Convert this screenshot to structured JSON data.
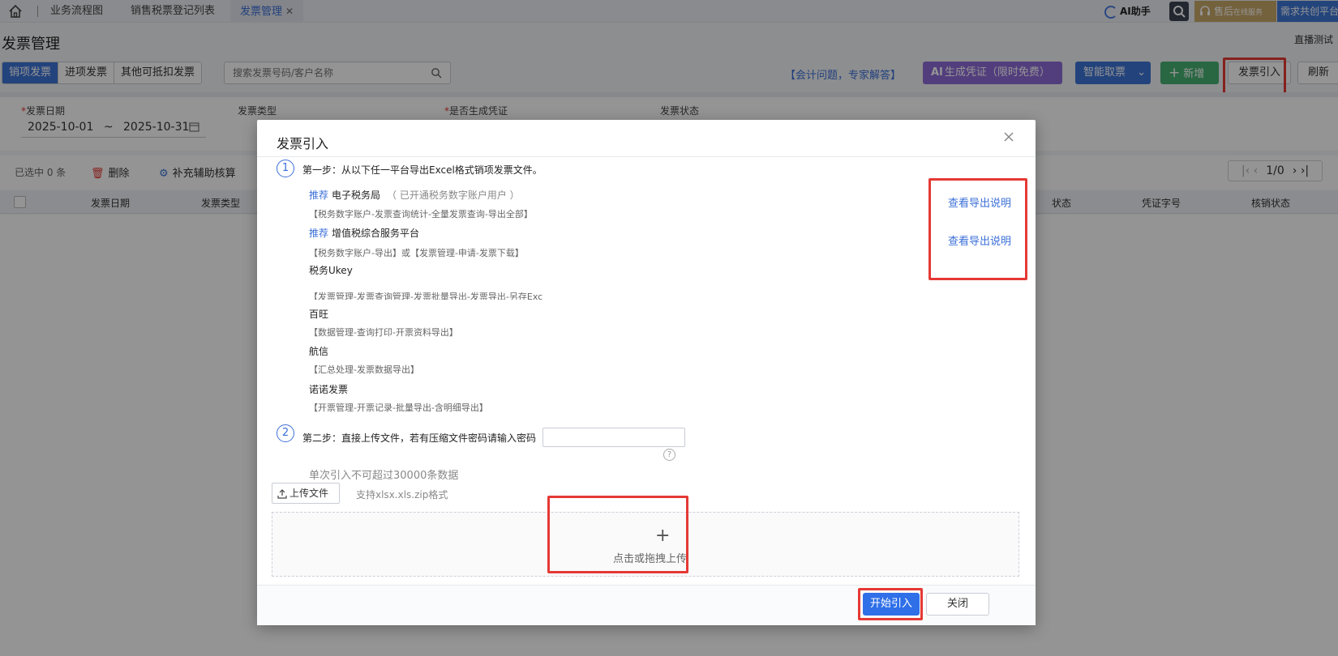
{
  "tabs": [
    {
      "label": "业务流程图",
      "active": false
    },
    {
      "label": "销售税票登记列表",
      "active": false
    },
    {
      "label": "发票管理",
      "active": true
    }
  ],
  "header": {
    "ai_help": "AI助手",
    "after_sale": "售后",
    "after_sale_sub": "在线服务",
    "demand": "需求共创平台"
  },
  "page": {
    "title": "发票管理",
    "live_test": "直播测试"
  },
  "toolbar": {
    "segments": [
      {
        "label": "销项发票",
        "active": true
      },
      {
        "label": "进项发票",
        "active": false
      },
      {
        "label": "其他可抵扣发票",
        "active": false
      }
    ],
    "search_placeholder": "搜索发票号码/客户名称",
    "accounting_link": "【会计问题，专家解答】",
    "gen_voucher": "生成凭证（限时免费）",
    "smart_fetch": "智能取票",
    "new": "新增",
    "import": "发票引入",
    "refresh": "刷新"
  },
  "filters": {
    "date_label": "发票日期",
    "date_start": "2025-10-01",
    "date_sep": "~",
    "date_end": "2025-10-31",
    "type_label": "发票类型",
    "voucher_label": "是否生成凭证",
    "status_label": "发票状态"
  },
  "list": {
    "selected": "已选中 0 条",
    "delete": "删除",
    "aux": "补充辅助核算",
    "pager": "1/0",
    "columns": [
      "发票日期",
      "发票类型",
      "状态",
      "凭证字号",
      "核销状态"
    ]
  },
  "modal": {
    "title": "发票引入",
    "step1_num": "1",
    "step1": "第一步：从以下任一平台导出Excel格式销项发票文件。",
    "platforms": [
      {
        "rec": "推荐",
        "name": "电子税务局",
        "note": "（ 已开通税务数字账户用户 ）",
        "path": "【税务数字账户-发票查询统计-全量发票查询-导出全部】",
        "link": "查看导出说明"
      },
      {
        "rec": "推荐",
        "name": "增值税综合服务平台",
        "note": "",
        "path": "【税务数字账户-导出】或【发票管理-申请-发票下载】",
        "link": "查看导出说明"
      },
      {
        "rec": "",
        "name": "税务Ukey",
        "note": "",
        "path": "【发票管理-发票查询管理-发票批量导出-发票导出-另存Exc",
        "link": ""
      },
      {
        "rec": "",
        "name": "百旺",
        "note": "",
        "path": "【数据管理-查询打印-开票资料导出】",
        "link": ""
      },
      {
        "rec": "",
        "name": "航信",
        "note": "",
        "path": "【汇总处理-发票数据导出】",
        "link": ""
      },
      {
        "rec": "",
        "name": "诺诺发票",
        "note": "",
        "path": "【开票管理-开票记录-批量导出-含明细导出】",
        "link": ""
      }
    ],
    "step2_num": "2",
    "step2": "第二步：直接上传文件，若有压缩文件密码请输入密码",
    "limit": "单次引入不可超过30000条数据",
    "upload_btn": "上传文件",
    "formats": "支持xlsx.xls.zip格式",
    "dropzone_plus": "+",
    "dropzone_text": "点击或拖拽上传",
    "start": "开始引入",
    "close": "关闭",
    "help": "?"
  },
  "colors": {
    "primary": "#3d74d6",
    "purple": "#8e6bd8",
    "green": "#47b272",
    "highlight": "#e53935"
  }
}
